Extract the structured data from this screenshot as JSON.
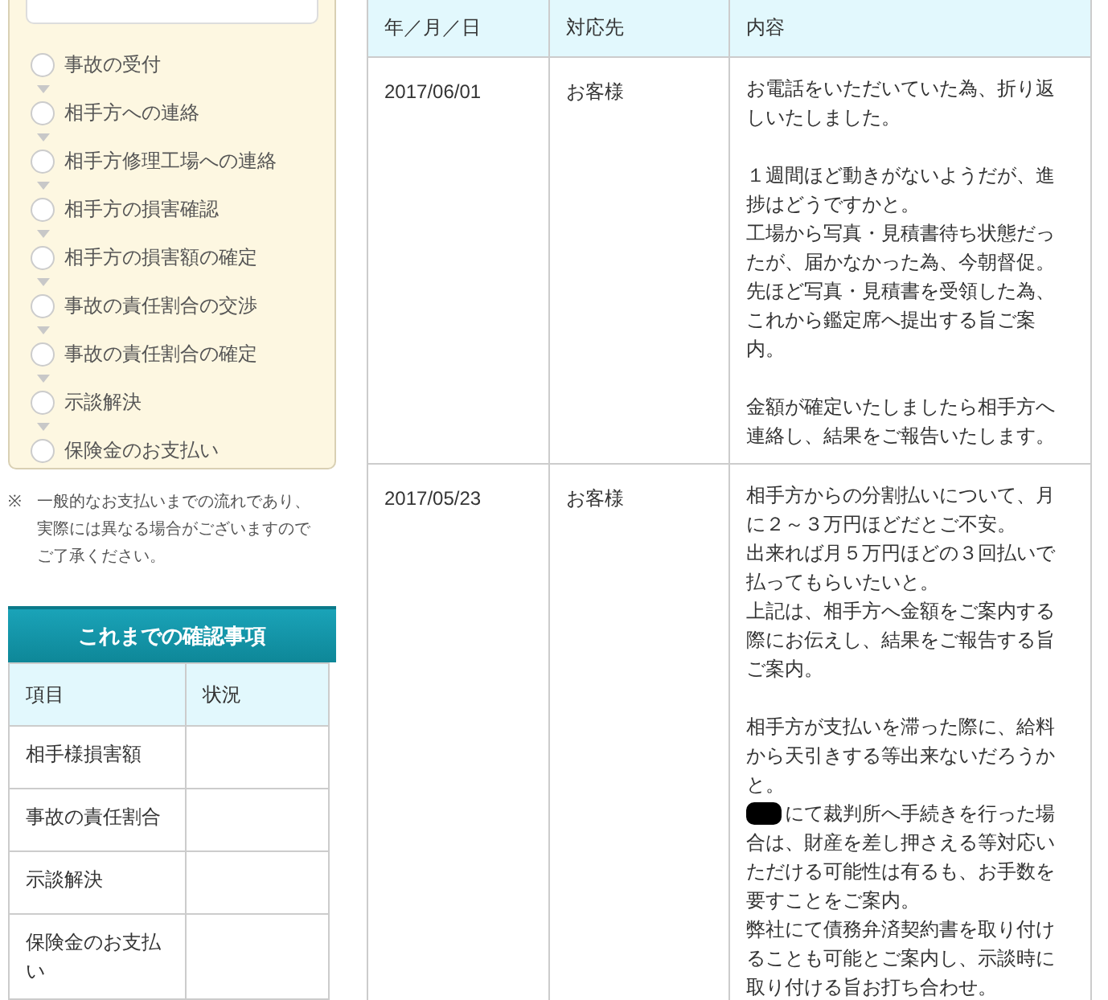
{
  "steps": [
    {
      "label": "事故の受付"
    },
    {
      "label": "相手方への連絡"
    },
    {
      "label": "相手方修理工場への連絡"
    },
    {
      "label": "相手方の損害確認"
    },
    {
      "label": "相手方の損害額の確定"
    },
    {
      "label": "事故の責任割合の交渉"
    },
    {
      "label": "事故の責任割合の確定"
    },
    {
      "label": "示談解決"
    },
    {
      "label": "保険金のお支払い"
    }
  ],
  "note": {
    "mark": "※",
    "text": "一般的なお支払いまでの流れであり、実際には異なる場合がございますのでご了承ください。"
  },
  "checklist": {
    "title": "これまでの確認事項",
    "columns": [
      "項目",
      "状況"
    ],
    "rows": [
      {
        "item": "相手様損害額"
      },
      {
        "item": "事故の責任割合"
      },
      {
        "item": "示談解決"
      },
      {
        "item": "保険金のお支払い"
      }
    ]
  },
  "history": {
    "columns": [
      "年／月／日",
      "対応先",
      "内容"
    ],
    "rows": [
      {
        "date": "2017/06/01",
        "party": "お客様",
        "paragraphs": [
          [
            {
              "text": "お電話をいただいていた為、折り返しいたしました。",
              "redacted": false
            }
          ],
          [
            {
              "text": "１週間ほど動きがないようだが、進捗はどうですかと。",
              "redacted": false
            },
            {
              "text": "工場から写真・見積書待ち状態だったが、届かなかった為、今朝督促。",
              "redacted": false
            },
            {
              "text": "先ほど写真・見積書を受領した為、これから鑑定席へ提出する旨ご案内。",
              "redacted": false
            }
          ],
          [
            {
              "text": "金額が確定いたしましたら相手方へ連絡し、結果をご報告いたします。",
              "redacted": false
            }
          ]
        ]
      },
      {
        "date": "2017/05/23",
        "party": "お客様",
        "paragraphs": [
          [
            {
              "text": "相手方からの分割払いについて、月に２～３万円ほどだとご不安。",
              "redacted": false
            },
            {
              "text": "出来れば月５万円ほどの３回払いで払ってもらいたいと。",
              "redacted": false
            },
            {
              "text": "上記は、相手方へ金額をご案内する際にお伝えし、結果をご報告する旨ご案内。",
              "redacted": false
            }
          ],
          [
            {
              "text": "相手方が支払いを滞った際に、給料から天引きする等出来ないだろうかと。",
              "redacted": false
            },
            {
              "text": "にて裁判所へ手続きを行った場合は、財産を差し押さえる等対応いただける可能性は有るも、お手数を要すことをご案内。",
              "redacted": true
            },
            {
              "text": "弊社にて債務弁済契約書を取り付けることも可能とご案内し、示談時に取り付ける旨お打ち合わせ。",
              "redacted": false
            }
          ]
        ]
      }
    ]
  }
}
